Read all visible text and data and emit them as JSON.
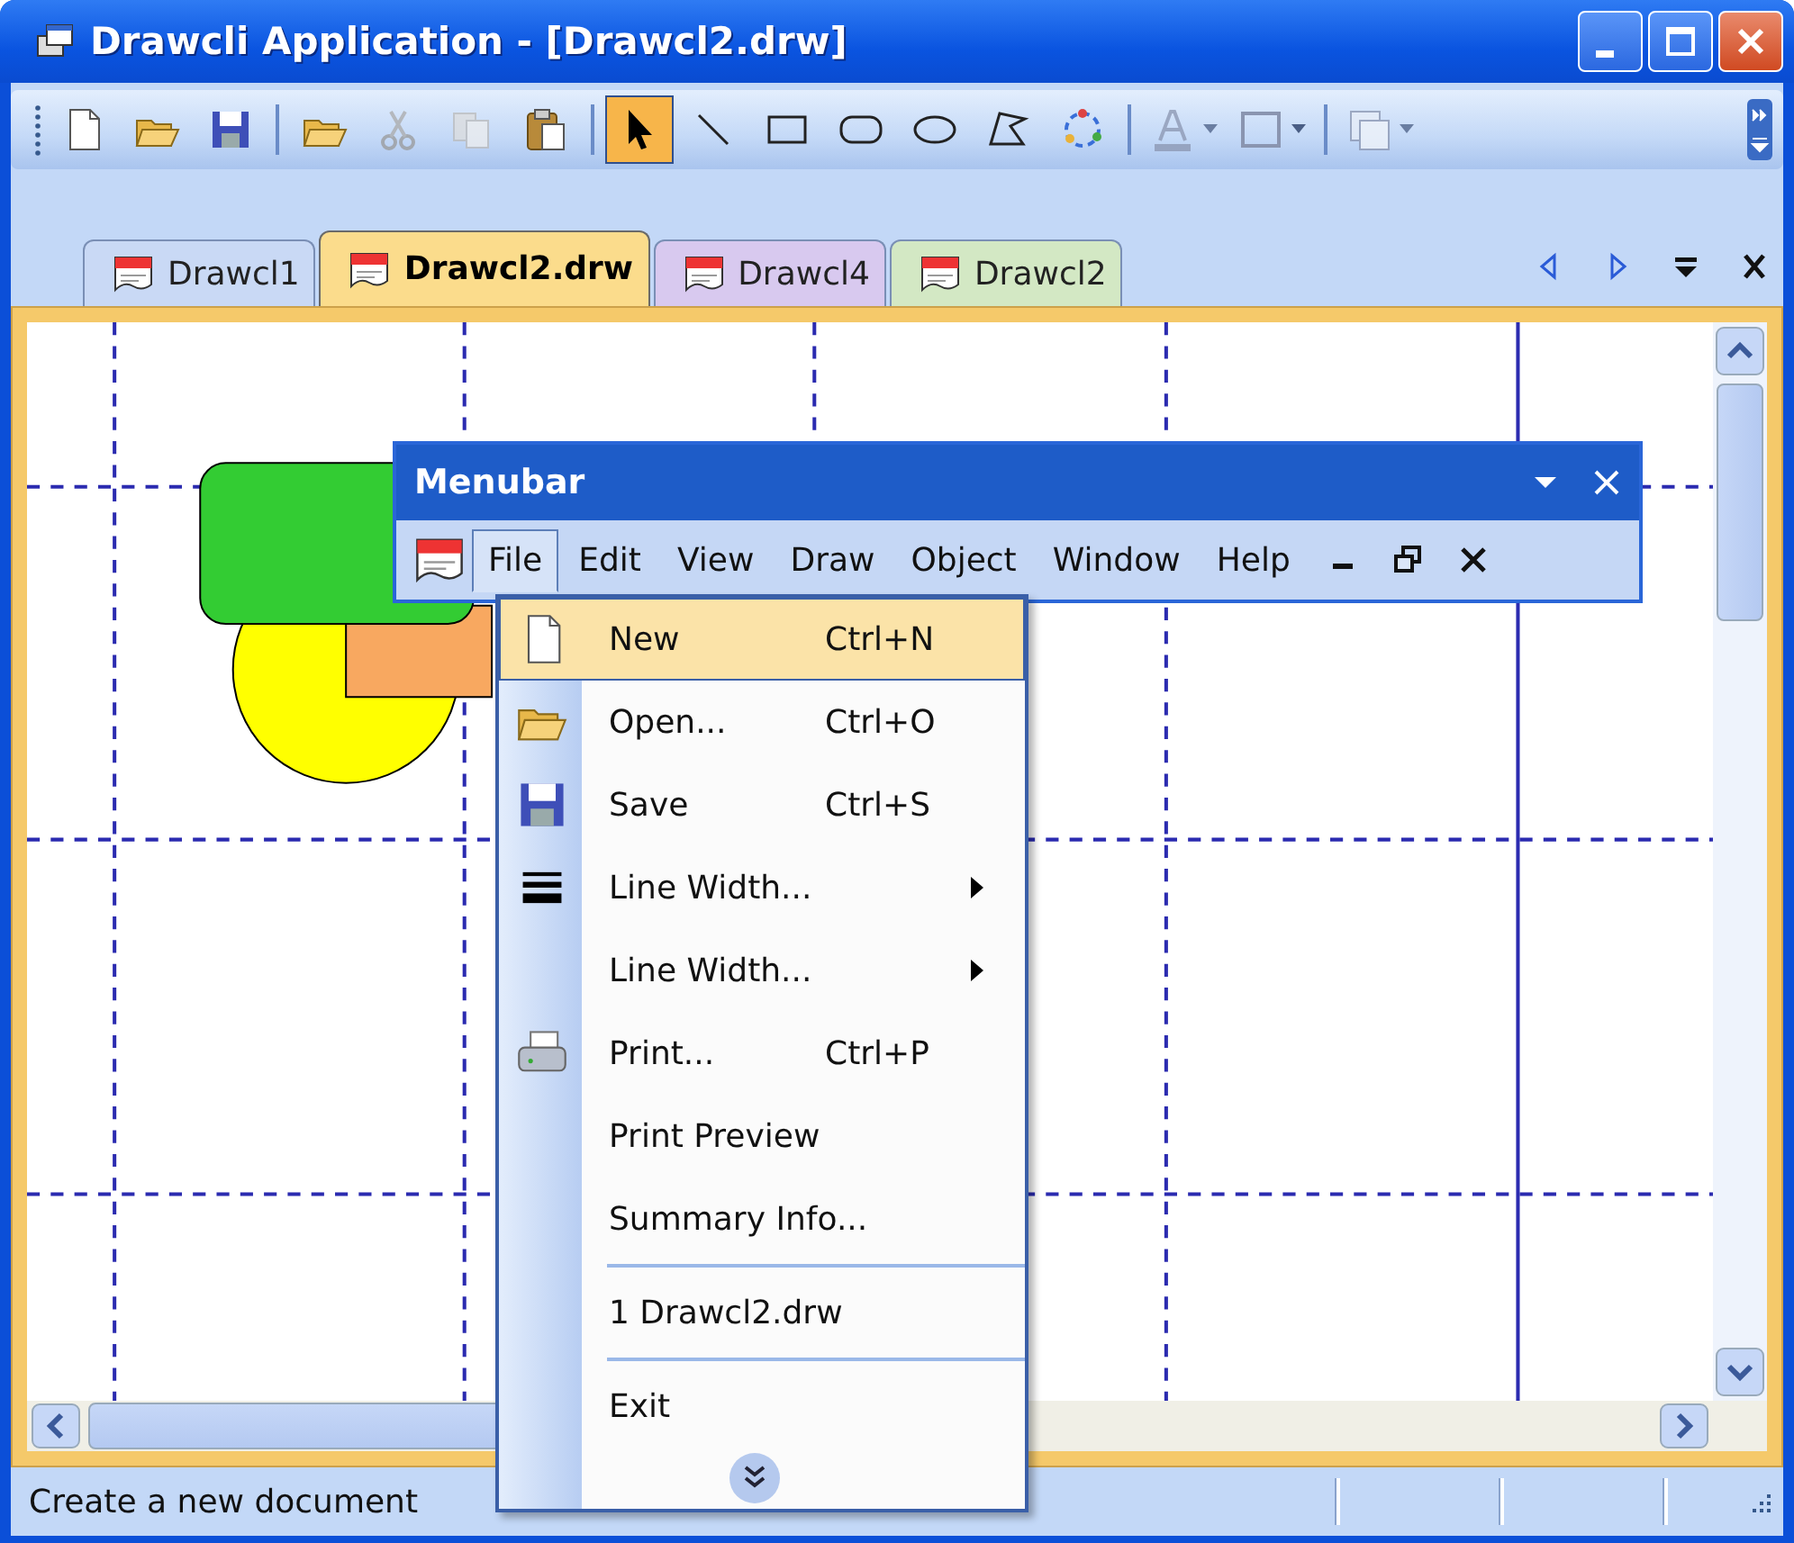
{
  "window": {
    "title": "Drawcli Application - [Drawcl2.drw]"
  },
  "toolbar": [
    {
      "kind": "new",
      "selected": false,
      "disabled": false
    },
    {
      "kind": "open",
      "selected": false,
      "disabled": false
    },
    {
      "kind": "save",
      "selected": false,
      "disabled": false
    },
    {
      "kind": "separator"
    },
    {
      "kind": "open",
      "selected": false,
      "disabled": false
    },
    {
      "kind": "cut",
      "selected": false,
      "disabled": true
    },
    {
      "kind": "copy",
      "selected": false,
      "disabled": true
    },
    {
      "kind": "paste",
      "selected": false,
      "disabled": false
    },
    {
      "kind": "separator"
    },
    {
      "kind": "pointer",
      "selected": true,
      "disabled": false
    },
    {
      "kind": "line",
      "selected": false,
      "disabled": false
    },
    {
      "kind": "rectangle",
      "selected": false,
      "disabled": false
    },
    {
      "kind": "rounded-rectangle",
      "selected": false,
      "disabled": false
    },
    {
      "kind": "ellipse",
      "selected": false,
      "disabled": false
    },
    {
      "kind": "polygon",
      "selected": false,
      "disabled": false
    },
    {
      "kind": "rotate",
      "selected": false,
      "disabled": false
    },
    {
      "kind": "separator"
    },
    {
      "kind": "font-color",
      "selected": false,
      "disabled": true
    },
    {
      "kind": "line-color",
      "selected": false,
      "disabled": false
    },
    {
      "kind": "separator"
    },
    {
      "kind": "frame",
      "selected": false,
      "disabled": true
    }
  ],
  "tabs": [
    {
      "label": "Drawcl1",
      "selected": false,
      "color": "#c9d9f5"
    },
    {
      "label": "Drawcl2.drw",
      "selected": true,
      "color": "#fbdc8c"
    },
    {
      "label": "Drawcl4",
      "selected": false,
      "color": "#d8c9ef"
    },
    {
      "label": "Drawcl2",
      "selected": false,
      "color": "#d3e8c4"
    }
  ],
  "menubar": {
    "title": "Menubar",
    "menus": [
      {
        "label": "File",
        "selected": true
      },
      {
        "label": "Edit",
        "selected": false
      },
      {
        "label": "View",
        "selected": false
      },
      {
        "label": "Draw",
        "selected": false
      },
      {
        "label": "Object",
        "selected": false
      },
      {
        "label": "Window",
        "selected": false
      },
      {
        "label": "Help",
        "selected": false
      }
    ]
  },
  "file_menu": {
    "items": [
      {
        "kind": "item",
        "label": "New",
        "shortcut": "Ctrl+N",
        "selected": true
      },
      {
        "kind": "item",
        "label": "Open...",
        "shortcut": "Ctrl+O",
        "selected": false
      },
      {
        "kind": "item",
        "label": "Save",
        "shortcut": "Ctrl+S",
        "selected": false
      },
      {
        "kind": "submenu",
        "label": "Line Width...",
        "selected": false
      },
      {
        "kind": "submenu",
        "label": "Line Width...",
        "selected": false
      },
      {
        "kind": "item",
        "label": "Print...",
        "shortcut": "Ctrl+P",
        "selected": false
      },
      {
        "kind": "item",
        "label": "Print Preview",
        "selected": false
      },
      {
        "kind": "item",
        "label": "Summary Info...",
        "selected": false
      },
      {
        "kind": "separator"
      },
      {
        "kind": "item",
        "label": "1 Drawcl2.drw",
        "selected": false
      },
      {
        "kind": "separator"
      },
      {
        "kind": "item",
        "label": "Exit",
        "selected": false
      },
      {
        "kind": "expand"
      }
    ]
  },
  "status_bar": {
    "text": "Create a new document"
  }
}
